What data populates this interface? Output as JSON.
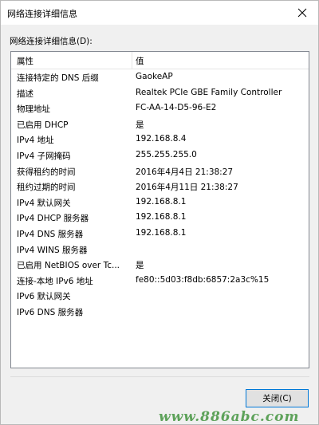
{
  "window": {
    "title": "网络连接详细信息",
    "close_icon": "close-icon"
  },
  "section_label": "网络连接详细信息(D):",
  "table": {
    "columns": [
      "属性",
      "值"
    ],
    "rows": [
      {
        "property": "连接特定的 DNS 后缀",
        "value": "GaokeAP"
      },
      {
        "property": "描述",
        "value": "Realtek PCIe GBE Family Controller"
      },
      {
        "property": "物理地址",
        "value": "FC-AA-14-D5-96-E2"
      },
      {
        "property": "已启用 DHCP",
        "value": "是"
      },
      {
        "property": "IPv4 地址",
        "value": "192.168.8.4"
      },
      {
        "property": "IPv4 子网掩码",
        "value": "255.255.255.0"
      },
      {
        "property": "获得租约的时间",
        "value": "2016年4月4日 21:38:27"
      },
      {
        "property": "租约过期的时间",
        "value": "2016年4月11日 21:38:27"
      },
      {
        "property": "IPv4 默认网关",
        "value": "192.168.8.1"
      },
      {
        "property": "IPv4 DHCP 服务器",
        "value": "192.168.8.1"
      },
      {
        "property": "IPv4 DNS 服务器",
        "value": "192.168.8.1"
      },
      {
        "property": "IPv4 WINS 服务器",
        "value": ""
      },
      {
        "property": "已启用 NetBIOS over Tc...",
        "value": "是"
      },
      {
        "property": "连接-本地 IPv6 地址",
        "value": "fe80::5d03:f8db:6857:2a3c%15"
      },
      {
        "property": "IPv6 默认网关",
        "value": ""
      },
      {
        "property": "IPv6 DNS 服务器",
        "value": ""
      }
    ]
  },
  "close_button": "关闭(C)",
  "watermark": "www.886abc.com"
}
